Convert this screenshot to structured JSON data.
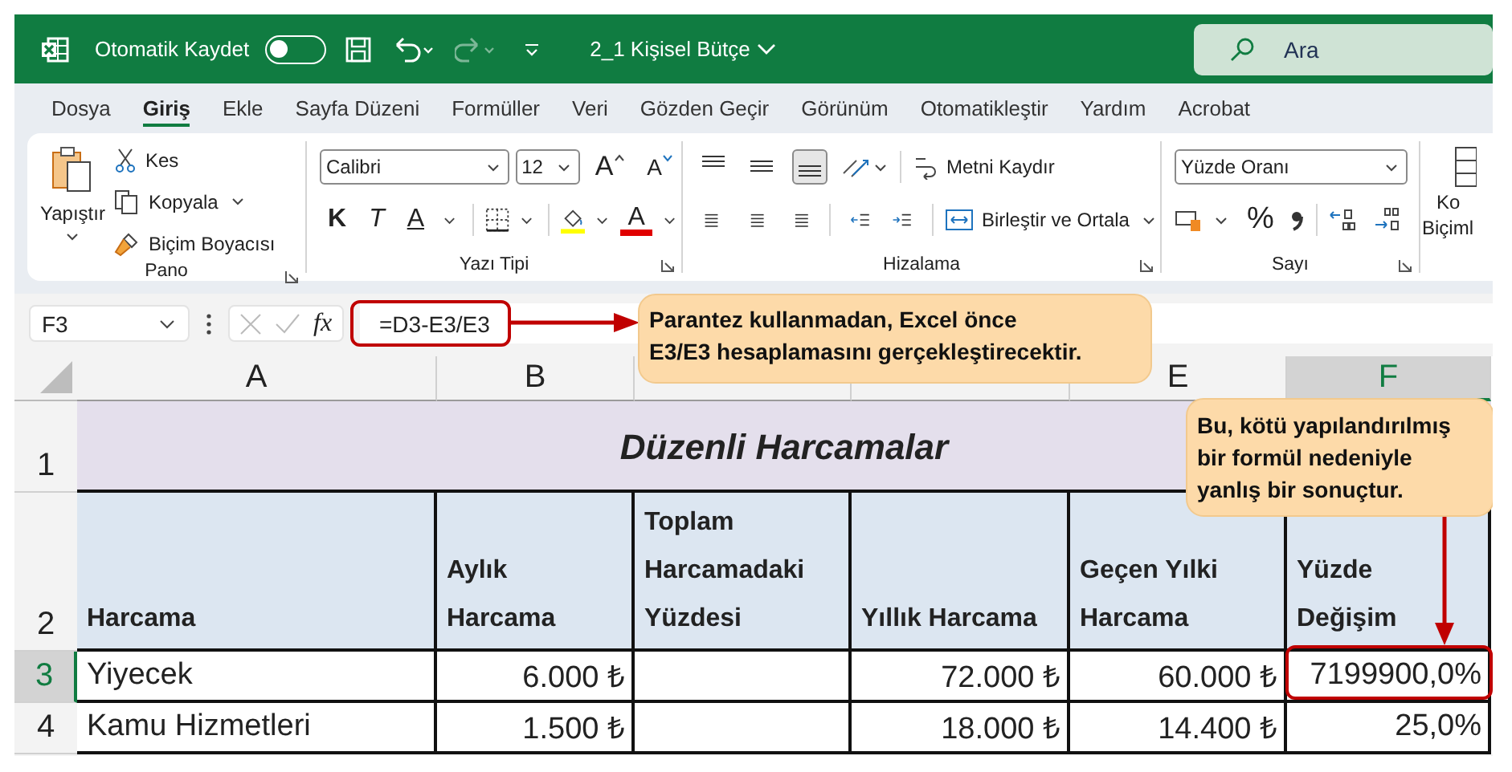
{
  "title_bar": {
    "autosave_label": "Otomatik Kaydet",
    "autosave_on": false,
    "file_name": "2_1 Kişisel Bütçe",
    "search_placeholder": "Ara"
  },
  "menu_tabs": [
    {
      "label": "Dosya",
      "selected": false
    },
    {
      "label": "Giriş",
      "selected": true
    },
    {
      "label": "Ekle",
      "selected": false
    },
    {
      "label": "Sayfa Düzeni",
      "selected": false
    },
    {
      "label": "Formüller",
      "selected": false
    },
    {
      "label": "Veri",
      "selected": false
    },
    {
      "label": "Gözden Geçir",
      "selected": false
    },
    {
      "label": "Görünüm",
      "selected": false
    },
    {
      "label": "Otomatikleştir",
      "selected": false
    },
    {
      "label": "Yardım",
      "selected": false
    },
    {
      "label": "Acrobat",
      "selected": false
    }
  ],
  "ribbon": {
    "clipboard": {
      "paste": "Yapıştır",
      "cut": "Kes",
      "copy": "Kopyala",
      "format_painter": "Biçim Boyacısı",
      "group": "Pano"
    },
    "font": {
      "font_name": "Calibri",
      "font_size": "12",
      "grow": "A",
      "shrink": "A",
      "bold": "K",
      "italic": "T",
      "underline": "A",
      "font_color": "A",
      "group": "Yazı Tipi"
    },
    "alignment": {
      "vertical": [
        {
          "selected": false
        },
        {
          "selected": false
        },
        {
          "selected": true
        }
      ],
      "wrap": "Metni Kaydır",
      "merge": "Birleştir ve Ortala",
      "group": "Hizalama"
    },
    "number": {
      "format": "Yüzde Oranı",
      "percent": "%",
      "group": "Sayı"
    },
    "styles": {
      "line_1": "Ko",
      "line_2": "Biçiml"
    }
  },
  "formula_bar": {
    "name_box": "F3",
    "fx": "fx",
    "formula": "=D3-E3/E3"
  },
  "sheet": {
    "columns": [
      {
        "header": "A",
        "selected": false
      },
      {
        "header": "B",
        "selected": false
      },
      {
        "selected": false
      },
      {
        "selected": false
      },
      {
        "header": "E",
        "selected": false
      },
      {
        "header": "F",
        "selected": true
      }
    ],
    "rows": [
      {
        "number": "1",
        "kind": "title",
        "selected": false,
        "title": "Düzenli Harcamalar"
      },
      {
        "number": "2",
        "kind": "header",
        "selected": false,
        "cells": [
          "Harcama",
          "Aylık\nHarcama",
          "Toplam\nHarcamadaki\nYüzdesi",
          "Yıllık Harcama",
          "Geçen Yılki\nHarcama",
          "Yüzde\nDeğişim"
        ]
      },
      {
        "number": "3",
        "kind": "data",
        "selected": true,
        "cells": [
          "Yiyecek",
          "6.000 ₺",
          null,
          "72.000 ₺",
          "60.000 ₺",
          "7199900,0%"
        ]
      },
      {
        "number": "4",
        "kind": "data",
        "selected": false,
        "cells": [
          "Kamu Hizmetleri",
          "1.500 ₺",
          null,
          "18.000 ₺",
          "14.400 ₺",
          "25,0%"
        ]
      }
    ]
  },
  "callouts": [
    {
      "text": "Parantez kullanmadan, Excel önce\nE3/E3 hesaplamasını gerçekleştirecektir."
    },
    {
      "text": "Bu, kötü yapılandırılmış\nbir formül nedeniyle\nyanlış bir sonuçtur."
    }
  ]
}
